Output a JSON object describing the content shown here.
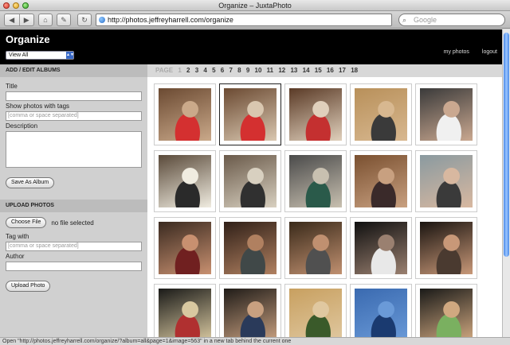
{
  "window": {
    "title": "Organize – JuxtaPhoto"
  },
  "toolbar": {
    "back_glyph": "◀",
    "forward_glyph": "▶",
    "home_glyph": "⌂",
    "edit_glyph": "✎",
    "reload_glyph": "↻",
    "url": "http://photos.jeffreyharrell.com/organize",
    "search_placeholder": "Google",
    "search_glyph": "⌕"
  },
  "header": {
    "title": "Organize",
    "view_select": "View All",
    "links": [
      "my photos",
      "logout"
    ]
  },
  "albums": {
    "header": "ADD / EDIT ALBUMS",
    "title_label": "Title",
    "tags_label": "Show photos with tags",
    "tags_placeholder": "[comma or space separated]",
    "description_label": "Description",
    "save_button": "Save As Album"
  },
  "upload": {
    "header": "UPLOAD PHOTOS",
    "choose_button": "Choose File",
    "no_file": "no file selected",
    "tag_label": "Tag with",
    "tag_placeholder": "[comma or space separated]",
    "author_label": "Author",
    "upload_button": "Upload Photo"
  },
  "pager": {
    "label": "PAGE",
    "current": "1",
    "pages": [
      "2",
      "3",
      "4",
      "5",
      "6",
      "7",
      "8",
      "9",
      "10",
      "11",
      "12",
      "13",
      "14",
      "15",
      "16",
      "17",
      "18"
    ]
  },
  "photos_selected_index": 1,
  "colors": {
    "header_bg": "#000000",
    "scroll_accent": "#4a8ae8",
    "sidebar_bg": "#d0d0d0"
  },
  "statusbar": "Open \"http://photos.jeffreyharrell.com/organize/?album=all&page=1&image=563\" in a new tab behind the current one"
}
